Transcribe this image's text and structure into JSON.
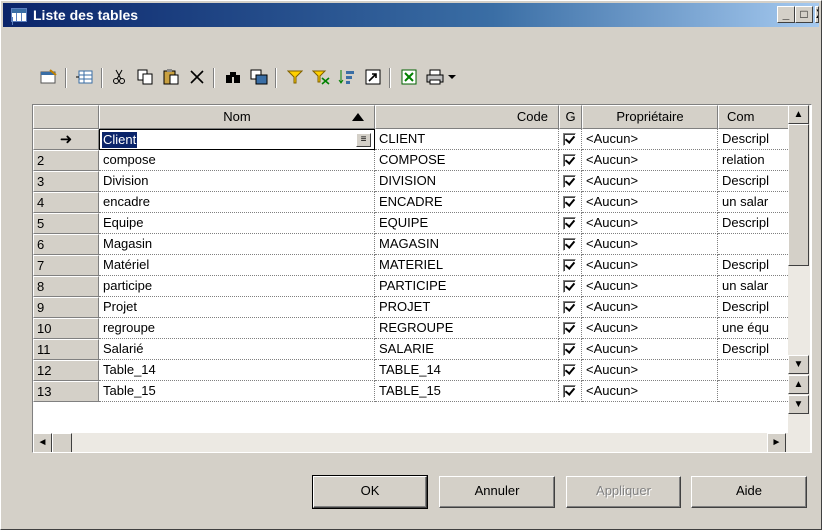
{
  "window": {
    "title": "Liste des tables",
    "min_label": "_",
    "max_label": "□",
    "close_label": "X"
  },
  "toolbar": {
    "icons": [
      "properties-icon",
      "insert-row-icon",
      "cut-icon",
      "copy-icon",
      "paste-icon",
      "delete-icon",
      "find-icon",
      "replace-icon",
      "filter-icon",
      "filter-clear-icon",
      "sort-icon",
      "open-icon",
      "excel-export-icon",
      "print-icon",
      "dropdown-arrow-icon"
    ]
  },
  "grid": {
    "headers": {
      "nom": "Nom",
      "code": "Code",
      "g": "G",
      "proprietaire": "Propriétaire",
      "commentaire": "Com"
    },
    "rows": [
      {
        "num": "",
        "nom": "Client",
        "code": "CLIENT",
        "g": true,
        "owner": "<Aucun>",
        "comment": "Descripl",
        "current": true
      },
      {
        "num": "2",
        "nom": "compose",
        "code": "COMPOSE",
        "g": true,
        "owner": "<Aucun>",
        "comment": "relation"
      },
      {
        "num": "3",
        "nom": "Division",
        "code": "DIVISION",
        "g": true,
        "owner": "<Aucun>",
        "comment": "Descripl"
      },
      {
        "num": "4",
        "nom": "encadre",
        "code": "ENCADRE",
        "g": true,
        "owner": "<Aucun>",
        "comment": "un salar"
      },
      {
        "num": "5",
        "nom": "Equipe",
        "code": "EQUIPE",
        "g": true,
        "owner": "<Aucun>",
        "comment": "Descripl"
      },
      {
        "num": "6",
        "nom": "Magasin",
        "code": "MAGASIN",
        "g": true,
        "owner": "<Aucun>",
        "comment": ""
      },
      {
        "num": "7",
        "nom": "Matériel",
        "code": "MATERIEL",
        "g": true,
        "owner": "<Aucun>",
        "comment": "Descripl"
      },
      {
        "num": "8",
        "nom": "participe",
        "code": "PARTICIPE",
        "g": true,
        "owner": "<Aucun>",
        "comment": "un salar"
      },
      {
        "num": "9",
        "nom": "Projet",
        "code": "PROJET",
        "g": true,
        "owner": "<Aucun>",
        "comment": "Descripl"
      },
      {
        "num": "10",
        "nom": "regroupe",
        "code": "REGROUPE",
        "g": true,
        "owner": "<Aucun>",
        "comment": "une équ"
      },
      {
        "num": "11",
        "nom": "Salarié",
        "code": "SALARIE",
        "g": true,
        "owner": "<Aucun>",
        "comment": "Descripl"
      },
      {
        "num": "12",
        "nom": "Table_14",
        "code": "TABLE_14",
        "g": true,
        "owner": "<Aucun>",
        "comment": ""
      },
      {
        "num": "13",
        "nom": "Table_15",
        "code": "TABLE_15",
        "g": true,
        "owner": "<Aucun>",
        "comment": ""
      }
    ]
  },
  "buttons": {
    "ok": "OK",
    "cancel": "Annuler",
    "apply": "Appliquer",
    "help": "Aide"
  }
}
